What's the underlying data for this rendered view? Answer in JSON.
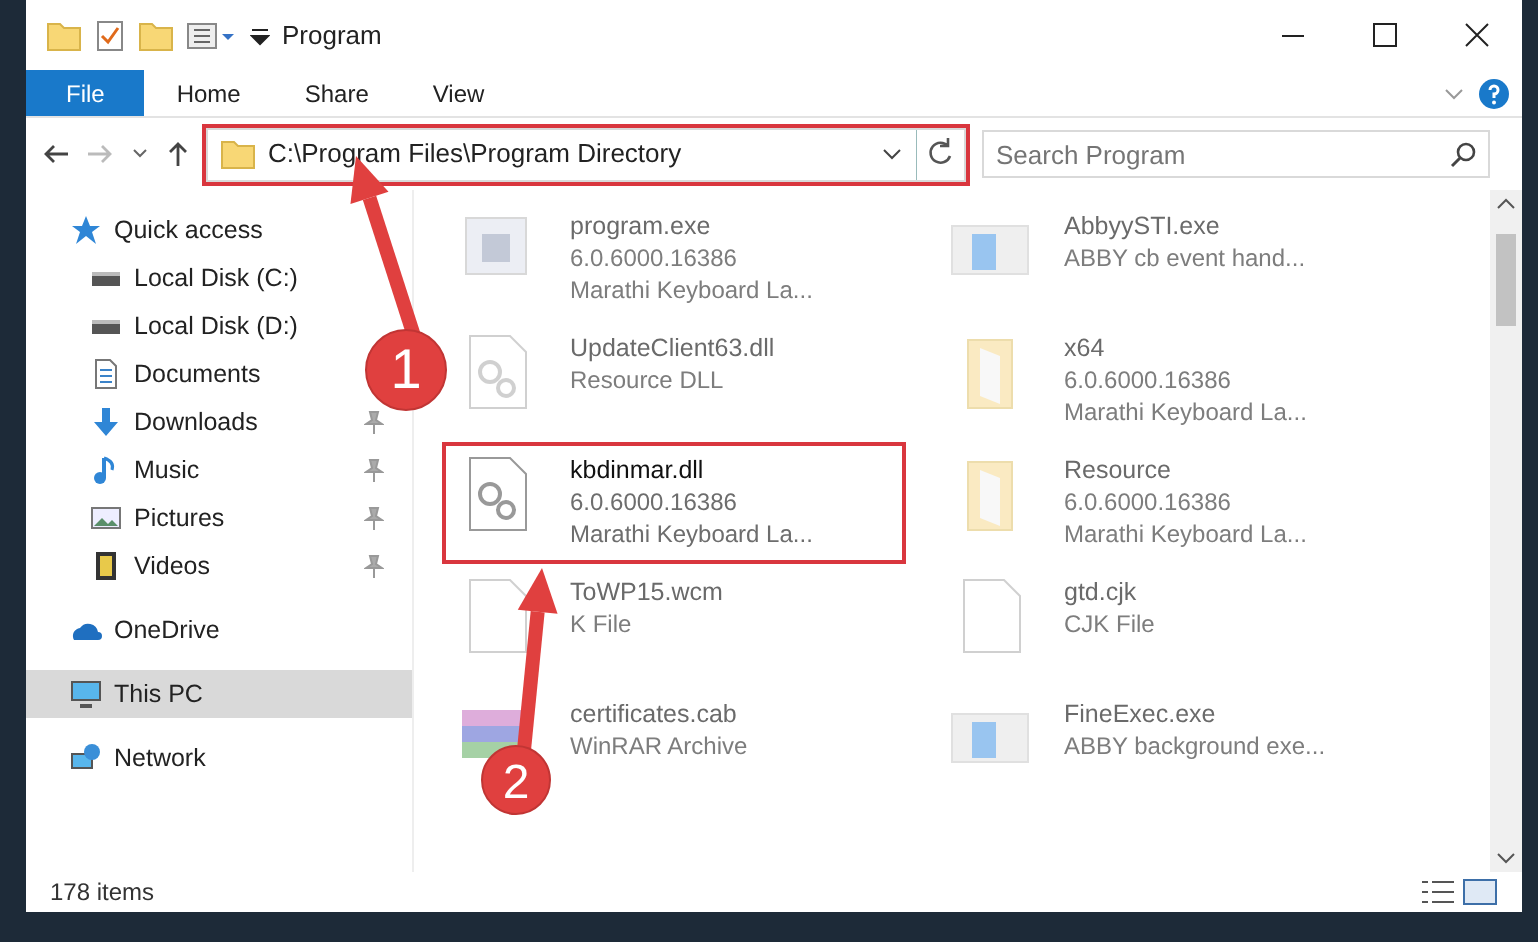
{
  "window": {
    "title": "Program"
  },
  "ribbon_tabs": [
    {
      "label": "File",
      "selected": true
    },
    {
      "label": "Home",
      "selected": false
    },
    {
      "label": "Share",
      "selected": false
    },
    {
      "label": "View",
      "selected": false
    }
  ],
  "address_bar": {
    "path": "C:\\Program Files\\Program Directory",
    "highlighted": true
  },
  "search": {
    "placeholder": "Search Program"
  },
  "sidebar": {
    "items": [
      {
        "label": "Quick access",
        "kind": "star",
        "pinned": false,
        "selected": false,
        "indent": false
      },
      {
        "label": "Local Disk (C:)",
        "kind": "drive",
        "pinned": false,
        "selected": false,
        "indent": true
      },
      {
        "label": "Local Disk (D:)",
        "kind": "drive",
        "pinned": false,
        "selected": false,
        "indent": true
      },
      {
        "label": "Documents",
        "kind": "document",
        "pinned": false,
        "selected": false,
        "indent": true
      },
      {
        "label": "Downloads",
        "kind": "download",
        "pinned": true,
        "selected": false,
        "indent": true
      },
      {
        "label": "Music",
        "kind": "music",
        "pinned": true,
        "selected": false,
        "indent": true
      },
      {
        "label": "Pictures",
        "kind": "picture",
        "pinned": true,
        "selected": false,
        "indent": true
      },
      {
        "label": "Videos",
        "kind": "video",
        "pinned": true,
        "selected": false,
        "indent": true
      },
      {
        "label": "OneDrive",
        "kind": "cloud",
        "pinned": false,
        "selected": false,
        "indent": false
      },
      {
        "label": "This PC",
        "kind": "pc",
        "pinned": false,
        "selected": true,
        "indent": false
      },
      {
        "label": "Network",
        "kind": "network",
        "pinned": false,
        "selected": false,
        "indent": false
      }
    ]
  },
  "files": [
    {
      "kind": "exe",
      "name": "program.exe",
      "lines": [
        "6.0.6000.16386",
        "Marathi Keyboard La..."
      ],
      "blurred": true,
      "highlighted": false
    },
    {
      "kind": "app",
      "name": "AbbyySTI.exe",
      "lines": [
        "ABBY cb event hand..."
      ],
      "blurred": true,
      "highlighted": false
    },
    {
      "kind": "dll",
      "name": "UpdateClient63.dll",
      "lines": [
        "Resource DLL"
      ],
      "blurred": true,
      "highlighted": false
    },
    {
      "kind": "folder",
      "name": "x64",
      "lines": [
        "6.0.6000.16386",
        "Marathi Keyboard La..."
      ],
      "blurred": true,
      "highlighted": false
    },
    {
      "kind": "dll",
      "name": "kbdinmar.dll",
      "lines": [
        "6.0.6000.16386",
        "Marathi Keyboard La..."
      ],
      "blurred": false,
      "highlighted": true
    },
    {
      "kind": "folder",
      "name": "Resource",
      "lines": [
        "6.0.6000.16386",
        "Marathi Keyboard La..."
      ],
      "blurred": true,
      "highlighted": false
    },
    {
      "kind": "blank",
      "name": "ToWP15.wcm",
      "lines": [
        "K File"
      ],
      "blurred": true,
      "highlighted": false
    },
    {
      "kind": "blank",
      "name": "gtd.cjk",
      "lines": [
        "CJK File"
      ],
      "blurred": true,
      "highlighted": false
    },
    {
      "kind": "archive",
      "name": "certificates.cab",
      "lines": [
        "WinRAR Archive"
      ],
      "blurred": true,
      "highlighted": false
    },
    {
      "kind": "app",
      "name": "FineExec.exe",
      "lines": [
        "ABBY background exe..."
      ],
      "blurred": true,
      "highlighted": false
    }
  ],
  "status_bar": {
    "count": "178 items"
  },
  "annotations": [
    {
      "number": "1"
    },
    {
      "number": "2"
    }
  ]
}
